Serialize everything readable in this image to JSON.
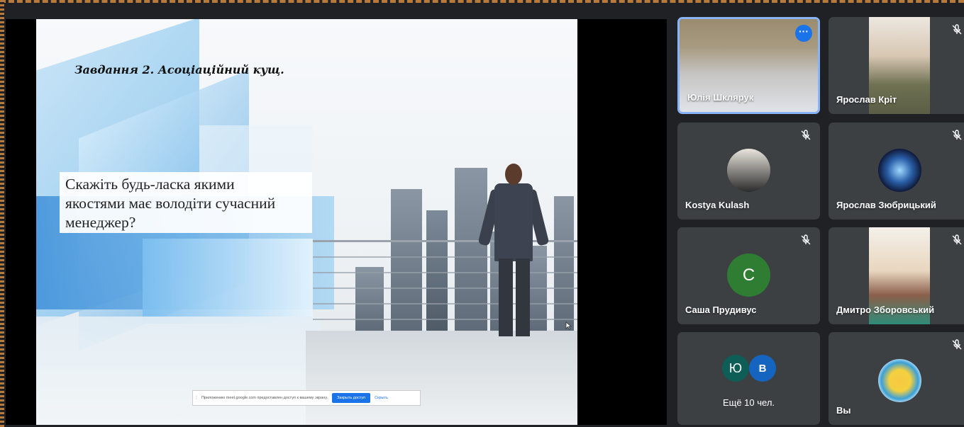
{
  "slide": {
    "title": "Завдання 2. Асоціаційний кущ.",
    "question": "Скажіть будь-ласка якими якостями має володіти сучасний менеджер?",
    "question_lines": [
      "Скажіть будь-ласка якими",
      "якостями має володіти сучасний",
      "менеджер?"
    ]
  },
  "share_bar": {
    "message": "Приложению meet.google.com предоставлен доступ к вашему экрану.",
    "stop_label": "Закрыть доступ",
    "hide_label": "Скрыть"
  },
  "participants": [
    {
      "name": "Юлія Шклярук",
      "muted": false,
      "active": true
    },
    {
      "name": "Ярослав Кріт",
      "muted": true
    },
    {
      "name": "Kostya Kulash",
      "muted": true
    },
    {
      "name": "Ярослав Зюбрицький",
      "muted": true
    },
    {
      "name": "Саша Прудивус",
      "muted": true,
      "avatar_letter": "С",
      "avatar_color": "#2e7d32"
    },
    {
      "name": "Дмитро Зборовський",
      "muted": true
    },
    {
      "name": "Вы",
      "muted": true
    }
  ],
  "more_tile": {
    "label": "Ещё 10 чел.",
    "avatars": [
      {
        "letter": "Ю",
        "color": "#0d5e57"
      },
      {
        "letter": "В",
        "color": "#1565c0"
      }
    ]
  },
  "icons": {
    "mute": "mic-off-icon",
    "more": "more-options-icon"
  },
  "colors": {
    "background": "#202124",
    "tile": "#3c4043",
    "active_border": "#8ab4f8",
    "accent": "#1a73e8"
  }
}
